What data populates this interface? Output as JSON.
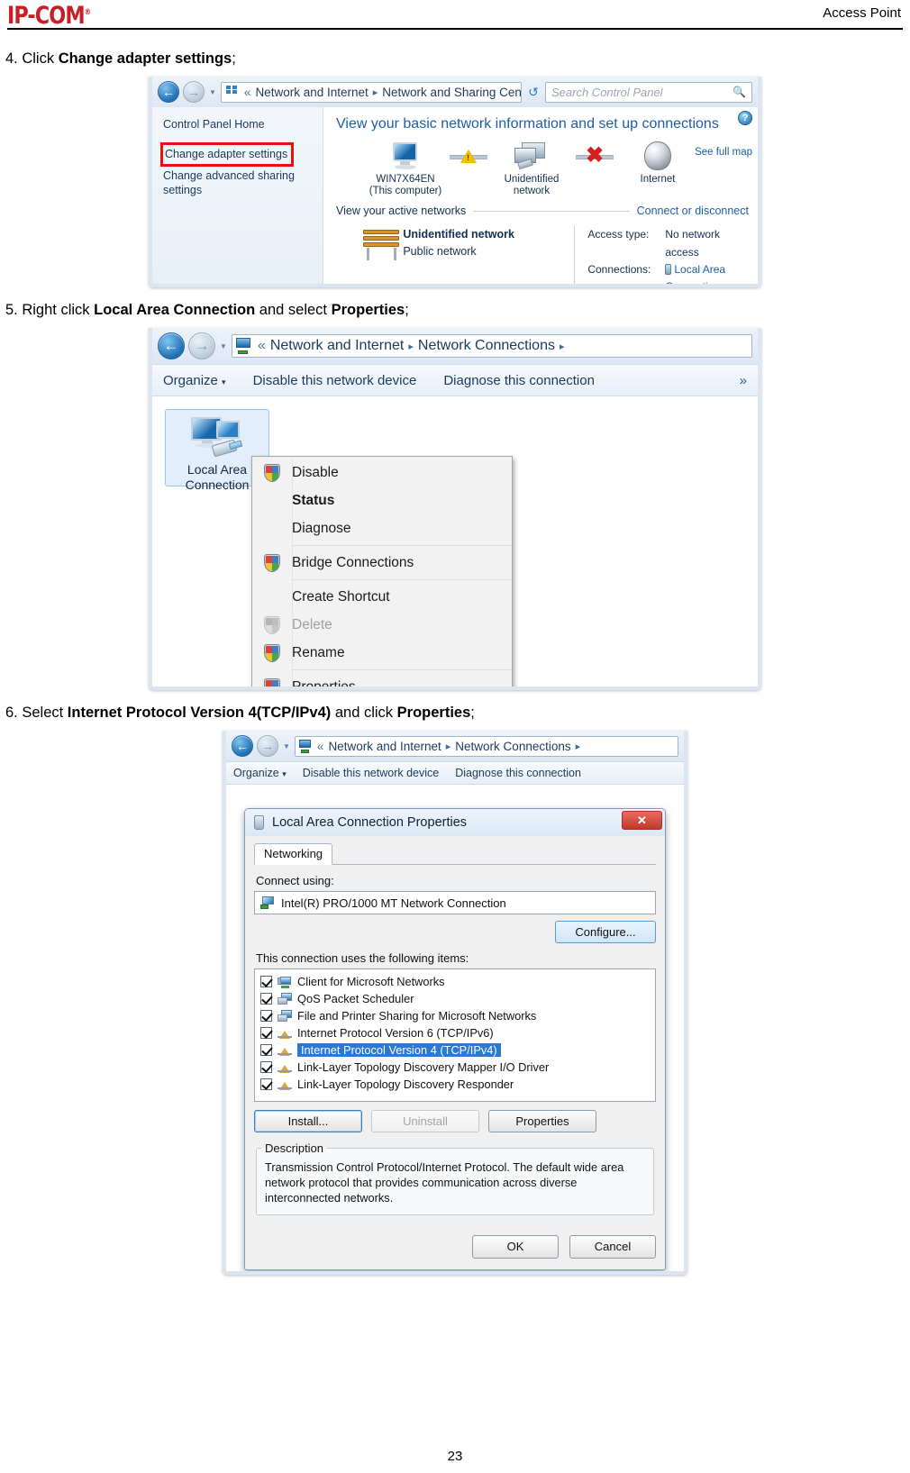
{
  "header": {
    "logo_text": "IP-COM",
    "logo_reg": "®",
    "title": "Access Point",
    "logo_color": "#c42026"
  },
  "steps": {
    "step4": {
      "num": "4. Click ",
      "bold": "Change adapter settings",
      "tail": ";"
    },
    "step5": {
      "num": "5. Right click ",
      "bold": "Local Area Connection",
      "mid": " and select ",
      "bold2": "Properties",
      "tail": ";"
    },
    "step6": {
      "num": "6. Select ",
      "bold": "Internet Protocol Version 4(TCP/IPv4)",
      "mid": " and click ",
      "bold2": "Properties",
      "tail": ";"
    }
  },
  "shot1": {
    "breadcrumb": {
      "chev": "«",
      "crumb1": "Network and Internet",
      "sep": "▸",
      "crumb2": "Network and Sharing Center",
      "sep2": "▸"
    },
    "search_placeholder": "Search Control Panel",
    "sidebar": {
      "home": "Control Panel Home",
      "change_adapter": "Change adapter settings",
      "change_sharing": "Change advanced sharing settings",
      "highlight_color": "#e8120c"
    },
    "headline": "View your basic network information and set up connections",
    "help_label": "?",
    "see_full_map": "See full map",
    "map_nodes": [
      {
        "label": "WIN7X64EN",
        "label2": "(This computer)",
        "icon": "computer-icon"
      },
      {
        "label": "Unidentified network",
        "label2": "",
        "icon": "network-icon"
      },
      {
        "label": "Internet",
        "label2": "",
        "icon": "globe-icon"
      }
    ],
    "active_networks_label": "View your active networks",
    "connect_disconnect": "Connect or disconnect",
    "network": {
      "name": "Unidentified network",
      "type": "Public network",
      "access_type_key": "Access type:",
      "access_type_val": "No network access",
      "connections_key": "Connections:",
      "connections_val": "Local Area Connection"
    }
  },
  "shot2": {
    "breadcrumb": {
      "chev": "«",
      "crumb1": "Network and Internet",
      "sep": "▸",
      "crumb2": "Network Connections",
      "sep2": "▸"
    },
    "toolbar": {
      "organize": "Organize",
      "organize_caret": "▾",
      "disable": "Disable this network device",
      "diagnose": "Diagnose this connection",
      "more": "»"
    },
    "connection_tile": {
      "line1": "Local Area",
      "line2": "Connection"
    },
    "context_menu": [
      {
        "label": "Disable",
        "bold": false,
        "disabled": false,
        "shield": true
      },
      {
        "label": "Status",
        "bold": true,
        "disabled": false,
        "shield": false
      },
      {
        "label": "Diagnose",
        "bold": false,
        "disabled": false,
        "shield": false
      },
      {
        "label": "Bridge Connections",
        "bold": false,
        "disabled": false,
        "shield": true
      },
      {
        "label": "Create Shortcut",
        "bold": false,
        "disabled": false,
        "shield": false
      },
      {
        "label": "Delete",
        "bold": false,
        "disabled": true,
        "shield": true
      },
      {
        "label": "Rename",
        "bold": false,
        "disabled": false,
        "shield": true
      },
      {
        "label": "Properties",
        "bold": false,
        "disabled": false,
        "shield": true
      }
    ]
  },
  "shot3": {
    "breadcrumb": {
      "chev": "«",
      "crumb1": "Network and Internet",
      "sep": "▸",
      "crumb2": "Network Connections",
      "sep2": "▸"
    },
    "toolbar": {
      "organize": "Organize",
      "organize_caret": "▾",
      "disable": "Disable this network device",
      "diagnose": "Diagnose this connection"
    },
    "dialog": {
      "title": "Local Area Connection Properties",
      "close_label": "✕",
      "tab": "Networking",
      "connect_using_label": "Connect using:",
      "adapter": "Intel(R) PRO/1000 MT Network Connection",
      "configure_button": "Configure...",
      "items_label": "This connection uses the following items:",
      "items": [
        {
          "label": "Client for Microsoft Networks",
          "checked": true,
          "selected": false,
          "icon": "client"
        },
        {
          "label": "QoS Packet Scheduler",
          "checked": true,
          "selected": false,
          "icon": "qos"
        },
        {
          "label": "File and Printer Sharing for Microsoft Networks",
          "checked": true,
          "selected": false,
          "icon": "qos"
        },
        {
          "label": "Internet Protocol Version 6 (TCP/IPv6)",
          "checked": true,
          "selected": false,
          "icon": "proto"
        },
        {
          "label": "Internet Protocol Version 4 (TCP/IPv4)",
          "checked": true,
          "selected": true,
          "icon": "proto"
        },
        {
          "label": "Link-Layer Topology Discovery Mapper I/O Driver",
          "checked": true,
          "selected": false,
          "icon": "proto"
        },
        {
          "label": "Link-Layer Topology Discovery Responder",
          "checked": true,
          "selected": false,
          "icon": "proto"
        }
      ],
      "install_button": "Install...",
      "uninstall_button": "Uninstall",
      "properties_button": "Properties",
      "description_legend": "Description",
      "description_text": "Transmission Control Protocol/Internet Protocol. The default wide area network protocol that provides communication across diverse interconnected networks.",
      "ok_button": "OK",
      "cancel_button": "Cancel",
      "selection_color": "#2a79d2"
    }
  },
  "footer": {
    "page_number": "23"
  }
}
